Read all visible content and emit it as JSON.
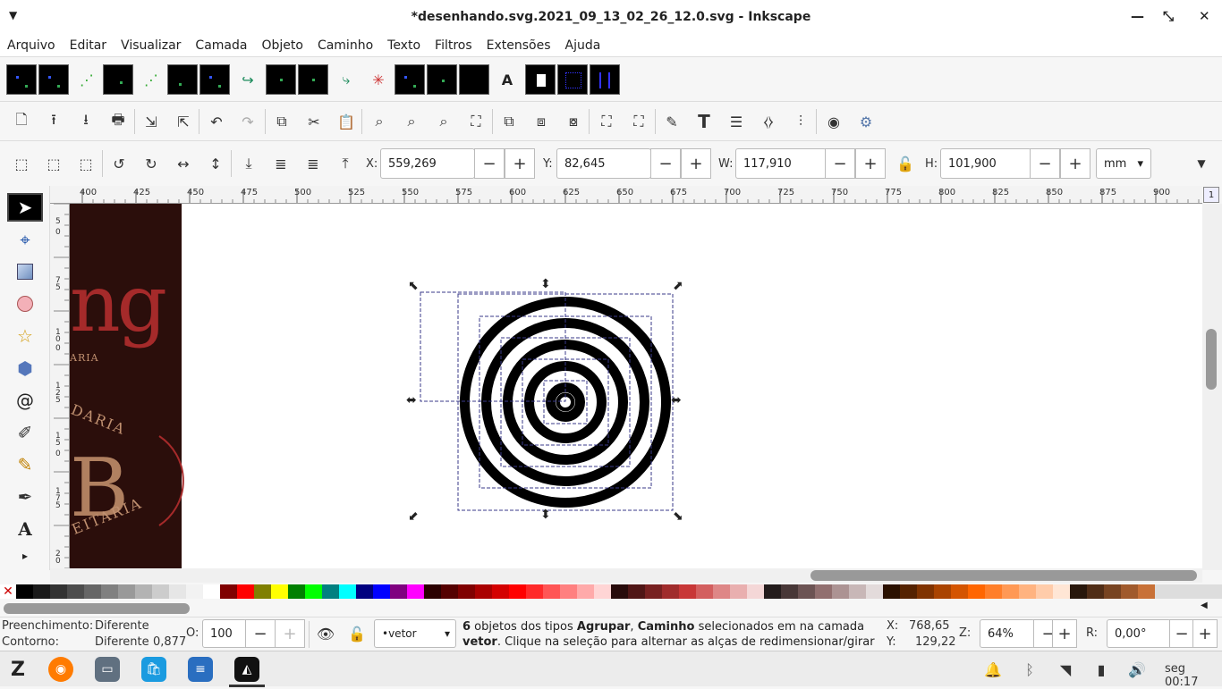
{
  "window": {
    "title": "*desenhando.svg.2021_09_13_02_26_12.0.svg - Inkscape"
  },
  "menu": [
    "Arquivo",
    "Editar",
    "Visualizar",
    "Camada",
    "Objeto",
    "Caminho",
    "Texto",
    "Filtros",
    "Extensões",
    "Ajuda"
  ],
  "selection_toolbar": {
    "x_label": "X:",
    "x_value": "559,269",
    "y_label": "Y:",
    "y_value": "82,645",
    "w_label": "W:",
    "w_value": "117,910",
    "h_label": "H:",
    "h_value": "101,900",
    "unit": "mm"
  },
  "ruler": {
    "h_ticks": [
      "400",
      "425",
      "450",
      "475",
      "500",
      "525",
      "550",
      "575",
      "600",
      "625",
      "650",
      "675",
      "700",
      "725",
      "750",
      "775",
      "800",
      "825",
      "850",
      "875",
      "900"
    ],
    "v_ticks": [
      "5",
      "0",
      "7",
      "5",
      "1",
      "0",
      "0",
      "1",
      "2",
      "5",
      "1",
      "5",
      "0",
      "1",
      "7",
      "5",
      "2",
      "0"
    ]
  },
  "canvas": {
    "side_text_1": "ng",
    "side_text_2": "ARIA",
    "side_text_3": "DARIA",
    "side_text_4": "B",
    "side_text_5": "EITARIA",
    "rings": 6
  },
  "palette": [
    "#000000",
    "#1a1a1a",
    "#333333",
    "#4d4d4d",
    "#666666",
    "#808080",
    "#999999",
    "#b3b3b3",
    "#cccccc",
    "#e6e6e6",
    "#f2f2f2",
    "#ffffff",
    "#800000",
    "#ff0000",
    "#808000",
    "#ffff00",
    "#008000",
    "#00ff00",
    "#008080",
    "#00ffff",
    "#000080",
    "#0000ff",
    "#800080",
    "#ff00ff",
    "#2b0000",
    "#550000",
    "#800000",
    "#aa0000",
    "#d40000",
    "#ff0000",
    "#ff2a2a",
    "#ff5555",
    "#ff8080",
    "#ffaaaa",
    "#ffd5d5",
    "#280b0b",
    "#501616",
    "#782121",
    "#a02c2c",
    "#c83737",
    "#d35f5f",
    "#de8787",
    "#e9afaf",
    "#f4d7d7",
    "#241c1c",
    "#483737",
    "#6c5353",
    "#916f6f",
    "#ac9393",
    "#c8b7b7",
    "#e3dbdb",
    "#2b1100",
    "#552200",
    "#803300",
    "#aa4400",
    "#d45500",
    "#ff6600",
    "#ff7f2a",
    "#ff9955",
    "#ffb380",
    "#ffccaa",
    "#ffe6d5",
    "#28170b",
    "#502d16",
    "#784421",
    "#a05a2c",
    "#c87137"
  ],
  "status": {
    "fill_label": "Preenchimento:",
    "fill_value": "Diferente",
    "stroke_label": "Contorno:",
    "stroke_value": "Diferente",
    "stroke_width": "0,877",
    "opacity_label": "O:",
    "opacity_value": "100",
    "layer": "•vetor",
    "message_count": "6",
    "message_part1": " objetos dos tipos ",
    "message_bold1": "Agrupar",
    "message_part2": ", ",
    "message_bold2": "Caminho",
    "message_part3": " selecionados em na camada",
    "message_bold3": "vetor",
    "message_part4": ". Clique na seleção para alternar as alças de redimensionar/girar ...",
    "cursor_x_label": "X:",
    "cursor_x": "768,65",
    "cursor_y_label": "Y:",
    "cursor_y": "129,22",
    "zoom_label": "Z:",
    "zoom": "64%",
    "rotation_label": "R:",
    "rotation": "0,00°"
  },
  "taskbar": {
    "clock": "seg 00:17"
  },
  "colors": {
    "canvas_dark": "#2b0e0b",
    "brand_red": "#a52a2a",
    "brand_tan": "#c09070",
    "selection_dash": "#3a3a8a"
  }
}
